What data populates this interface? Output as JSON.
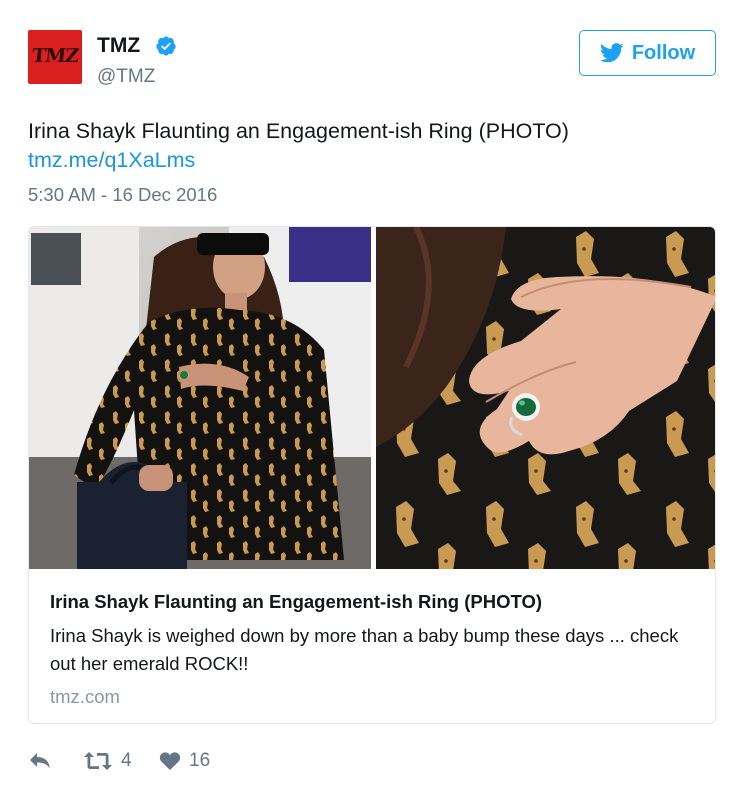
{
  "account": {
    "avatar_text": "TMZ",
    "name": "TMZ",
    "handle": "@TMZ",
    "verified": true,
    "verified_color": "#1da1f2"
  },
  "follow_button": {
    "label": "Follow",
    "icon": "twitter-bird-icon",
    "color": "#1da1f2"
  },
  "tweet": {
    "text": "Irina Shayk Flaunting an Engagement-ish Ring (PHOTO)",
    "link": "tmz.me/q1XaLms",
    "timestamp": "5:30 AM - 16 Dec 2016"
  },
  "card": {
    "title": "Irina Shayk Flaunting an Engagement-ish Ring (PHOTO)",
    "description": "Irina Shayk is weighed down by more than a baby bump these days ... check out her emerald ROCK!!",
    "domain": "tmz.com",
    "images": [
      "woman-in-leopard-print-dress-photo",
      "hand-with-emerald-ring-photo"
    ]
  },
  "actions": {
    "reply": {
      "icon": "reply-icon"
    },
    "retweet": {
      "icon": "retweet-icon",
      "count": "4"
    },
    "like": {
      "icon": "heart-icon",
      "count": "16"
    }
  },
  "colors": {
    "link": "#1b95e0",
    "secondary_text": "#657786",
    "card_border": "#e1e8ed",
    "tmz_red": "#d9201f"
  }
}
